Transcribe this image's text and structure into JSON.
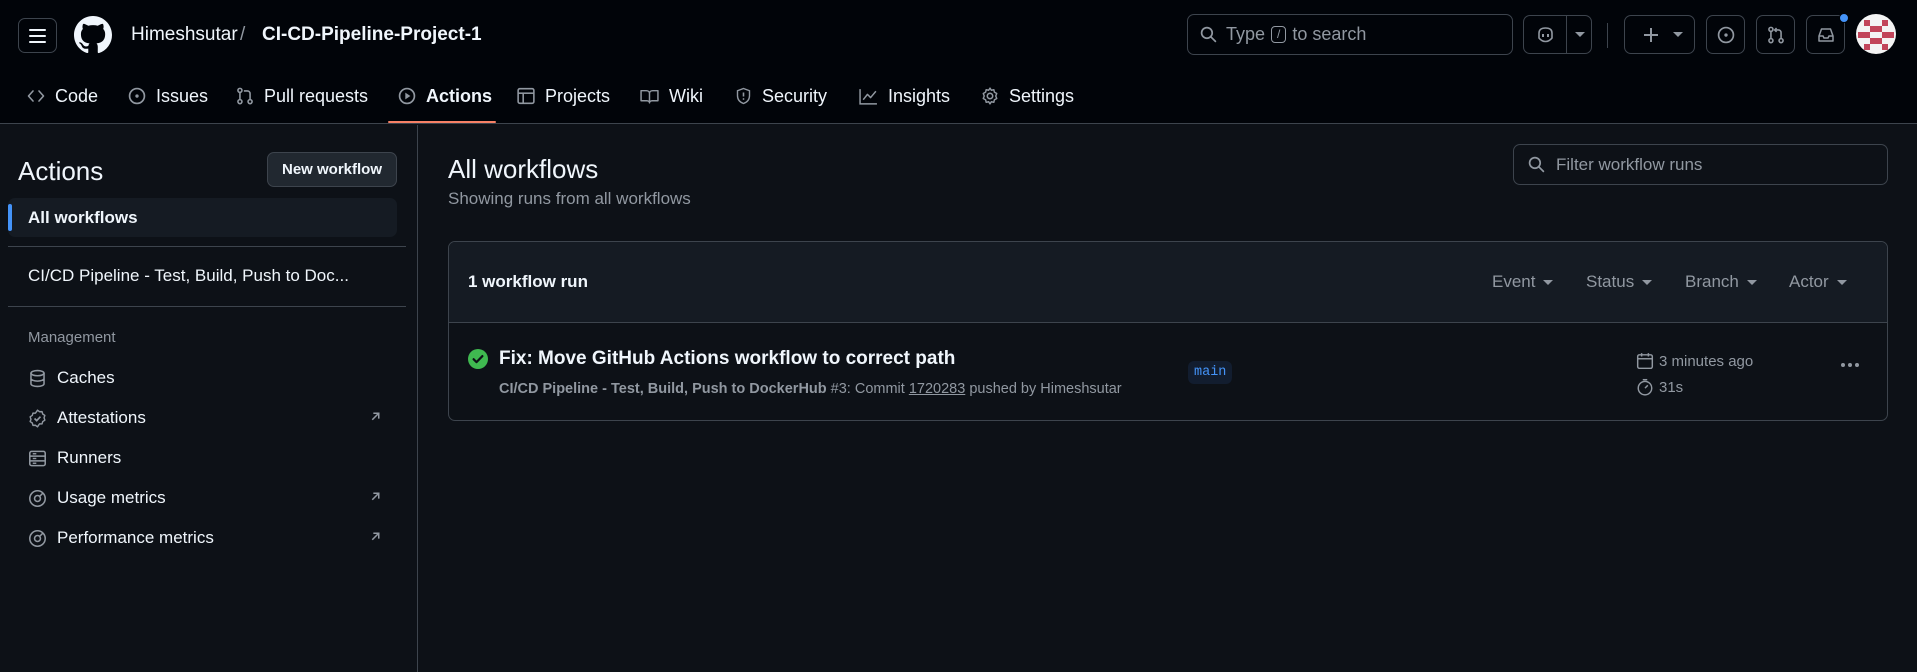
{
  "header": {
    "owner": "Himeshsutar",
    "separator": "/",
    "repo": "CI-CD-Pipeline-Project-1",
    "search_prefix": "Type",
    "search_key": "/",
    "search_suffix": "to search",
    "brand_color": "#f78166",
    "accent_color": "#4493f8"
  },
  "tabs": [
    {
      "label": "Code",
      "icon": "code-icon"
    },
    {
      "label": "Issues",
      "icon": "issue-icon"
    },
    {
      "label": "Pull requests",
      "icon": "pull-request-icon"
    },
    {
      "label": "Actions",
      "icon": "play-icon",
      "active": true
    },
    {
      "label": "Projects",
      "icon": "table-icon"
    },
    {
      "label": "Wiki",
      "icon": "book-icon"
    },
    {
      "label": "Security",
      "icon": "shield-icon"
    },
    {
      "label": "Insights",
      "icon": "graph-icon"
    },
    {
      "label": "Settings",
      "icon": "gear-icon"
    }
  ],
  "sidebar": {
    "title": "Actions",
    "new_workflow": "New workflow",
    "all_workflows": "All workflows",
    "workflow": "CI/CD Pipeline - Test, Build, Push to Doc...",
    "management_heading": "Management",
    "management": [
      {
        "label": "Caches",
        "icon": "database-icon",
        "external": false
      },
      {
        "label": "Attestations",
        "icon": "verified-icon",
        "external": true
      },
      {
        "label": "Runners",
        "icon": "server-icon",
        "external": false
      },
      {
        "label": "Usage metrics",
        "icon": "meter-icon",
        "external": true
      },
      {
        "label": "Performance metrics",
        "icon": "meter-icon",
        "external": true
      }
    ]
  },
  "main": {
    "title": "All workflows",
    "subtitle": "Showing runs from all workflows",
    "filter_placeholder": "Filter workflow runs",
    "runs_count": "1 workflow run",
    "filters": [
      "Event",
      "Status",
      "Branch",
      "Actor"
    ],
    "run": {
      "status": "success",
      "status_color": "#3fb950",
      "title": "Fix: Move GitHub Actions workflow to correct path",
      "workflow": "CI/CD Pipeline - Test, Build, Push to DockerHub",
      "run_number": "#3",
      "commit_prefix": ": Commit",
      "commit_sha": "1720283",
      "pushed_by": "pushed by Himeshsutar",
      "branch": "main",
      "time_ago": "3 minutes ago",
      "duration": "31s"
    }
  }
}
